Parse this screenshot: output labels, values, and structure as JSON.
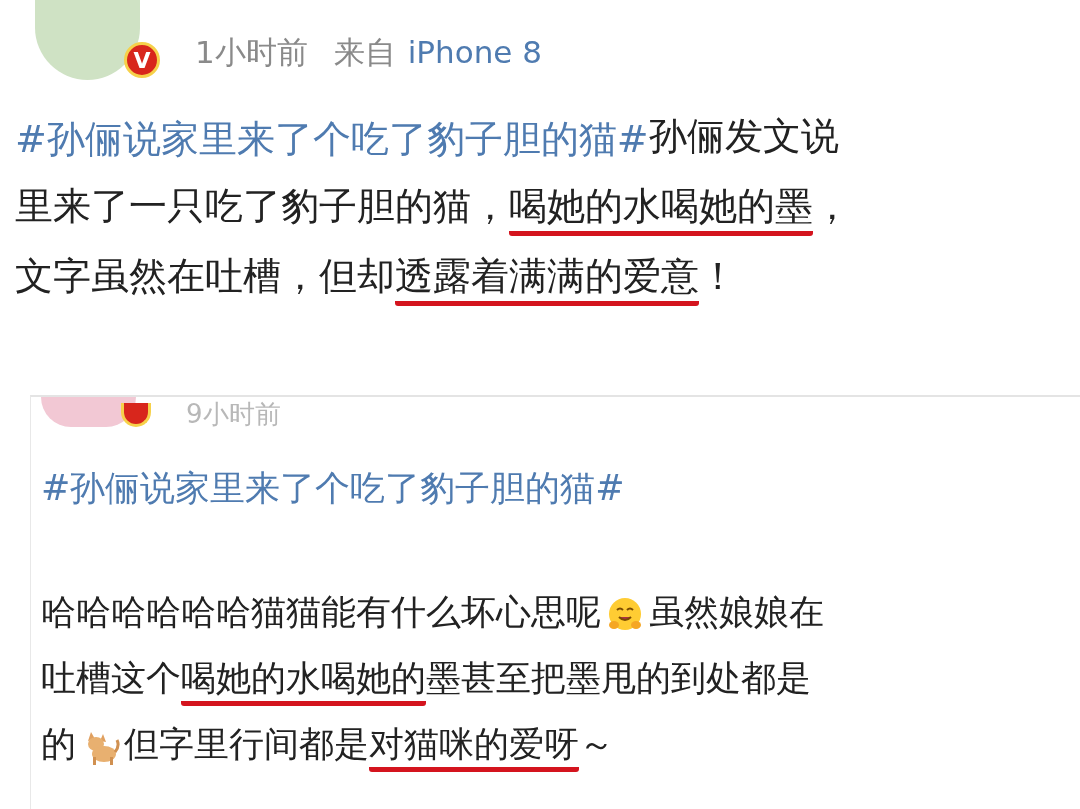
{
  "posts": [
    {
      "badge": "V",
      "time": "1小时前",
      "source_prefix": "来自",
      "source": "iPhone 8",
      "lines": [
        [
          {
            "kind": "hashtag",
            "text": "#孙俪说家里来了个吃了豹子胆的猫#"
          },
          {
            "kind": "text",
            "text": " 孙俪发文说",
            "underlined": false
          }
        ],
        [
          {
            "kind": "text",
            "text": "里来了一只吃了豹子胆的猫，",
            "underlined": false
          },
          {
            "kind": "text",
            "text": "喝她的水喝她的墨",
            "underlined": true
          },
          {
            "kind": "text",
            "text": "，",
            "underlined": false
          }
        ],
        [
          {
            "kind": "text",
            "text": "文字虽然在吐槽，但却",
            "underlined": false
          },
          {
            "kind": "text",
            "text": "透露着满满的爱意",
            "underlined": true
          },
          {
            "kind": "text",
            "text": "！",
            "underlined": false
          }
        ]
      ]
    },
    {
      "time": "9小时前",
      "hashtag_lines": [
        "#孙俪说家里来了个吃了豹子胆的猫#"
      ],
      "lines": [
        [
          {
            "kind": "text",
            "text": "哈哈哈哈哈哈猫猫能有什么坏心思呢",
            "underlined": false
          },
          {
            "kind": "emoji"
          },
          {
            "kind": "text",
            "text": "虽然娘娘在",
            "underlined": false
          }
        ],
        [
          {
            "kind": "text",
            "text": "吐槽这个",
            "underlined": false
          },
          {
            "kind": "text",
            "text": "喝她的水喝她的",
            "underlined": true
          },
          {
            "kind": "text",
            "text": "墨甚至把墨甩的到处都是",
            "underlined": false
          }
        ],
        [
          {
            "kind": "text",
            "text": "的",
            "underlined": false
          },
          {
            "kind": "emoji"
          },
          {
            "kind": "text",
            "text": "但字里行间都是",
            "underlined": false
          },
          {
            "kind": "text",
            "text": "对猫咪的爱呀",
            "underlined": true
          },
          {
            "kind": "text",
            "text": "～",
            "underlined": false
          }
        ]
      ]
    }
  ]
}
